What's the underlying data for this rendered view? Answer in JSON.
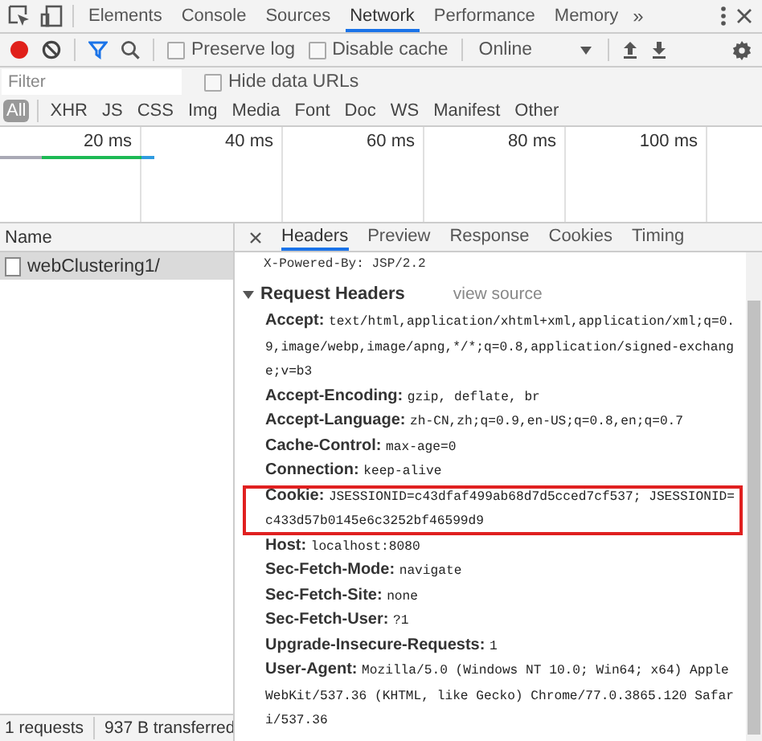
{
  "main_tabs": [
    {
      "label": "Elements",
      "selected": false
    },
    {
      "label": "Console",
      "selected": false
    },
    {
      "label": "Sources",
      "selected": false
    },
    {
      "label": "Network",
      "selected": true
    },
    {
      "label": "Performance",
      "selected": false
    },
    {
      "label": "Memory",
      "selected": false
    }
  ],
  "more_tabs": "»",
  "toolbar": {
    "preserve_log": {
      "label": "Preserve log",
      "checked": false
    },
    "disable_cache": {
      "label": "Disable cache",
      "checked": false
    },
    "throttling": "Online"
  },
  "filter": {
    "placeholder": "Filter",
    "hide_data_urls": {
      "label": "Hide data URLs",
      "checked": false
    }
  },
  "type_filters": [
    {
      "label": "All",
      "selected": true
    },
    {
      "label": "XHR",
      "selected": false
    },
    {
      "label": "JS",
      "selected": false
    },
    {
      "label": "CSS",
      "selected": false
    },
    {
      "label": "Img",
      "selected": false
    },
    {
      "label": "Media",
      "selected": false
    },
    {
      "label": "Font",
      "selected": false
    },
    {
      "label": "Doc",
      "selected": false
    },
    {
      "label": "WS",
      "selected": false
    },
    {
      "label": "Manifest",
      "selected": false
    },
    {
      "label": "Other",
      "selected": false
    }
  ],
  "timeline": {
    "ticks": [
      "20 ms",
      "40 ms",
      "60 ms",
      "80 ms",
      "100 ms"
    ]
  },
  "requests": {
    "column": "Name",
    "rows": [
      {
        "name": "webClustering1/",
        "selected": true
      }
    ]
  },
  "detail_tabs": [
    {
      "label": "Headers",
      "selected": true
    },
    {
      "label": "Preview",
      "selected": false
    },
    {
      "label": "Response",
      "selected": false
    },
    {
      "label": "Cookies",
      "selected": false
    },
    {
      "label": "Timing",
      "selected": false
    }
  ],
  "previous_header": "X-Powered-By: JSP/2.2",
  "section": {
    "title": "Request Headers",
    "expanded": true,
    "view_source": "view source",
    "headers": [
      {
        "name": "Accept:",
        "value": "text/html,application/xhtml+xml,application/xml;q=0.9,image/webp,image/apng,*/*;q=0.8,application/signed-exchange;v=b3",
        "highlighted": false
      },
      {
        "name": "Accept-Encoding:",
        "value": "gzip, deflate, br",
        "highlighted": false
      },
      {
        "name": "Accept-Language:",
        "value": "zh-CN,zh;q=0.9,en-US;q=0.8,en;q=0.7",
        "highlighted": false
      },
      {
        "name": "Cache-Control:",
        "value": "max-age=0",
        "highlighted": false
      },
      {
        "name": "Connection:",
        "value": "keep-alive",
        "highlighted": false
      },
      {
        "name": "Cookie:",
        "value": "JSESSIONID=c43dfaf499ab68d7d5cced7cf537; JSESSIONID=c433d57b0145e6c3252bf46599d9",
        "highlighted": true
      },
      {
        "name": "Host:",
        "value": "localhost:8080",
        "highlighted": false
      },
      {
        "name": "Sec-Fetch-Mode:",
        "value": "navigate",
        "highlighted": false
      },
      {
        "name": "Sec-Fetch-Site:",
        "value": "none",
        "highlighted": false
      },
      {
        "name": "Sec-Fetch-User:",
        "value": "?1",
        "highlighted": false
      },
      {
        "name": "Upgrade-Insecure-Requests:",
        "value": "1",
        "highlighted": false
      },
      {
        "name": "User-Agent:",
        "value": "Mozilla/5.0 (Windows NT 10.0; Win64; x64) AppleWebKit/537.36 (KHTML, like Gecko) Chrome/77.0.3865.120 Safari/537.36",
        "highlighted": false
      }
    ]
  },
  "status_bar": [
    "1 requests",
    "937 B transferred"
  ]
}
